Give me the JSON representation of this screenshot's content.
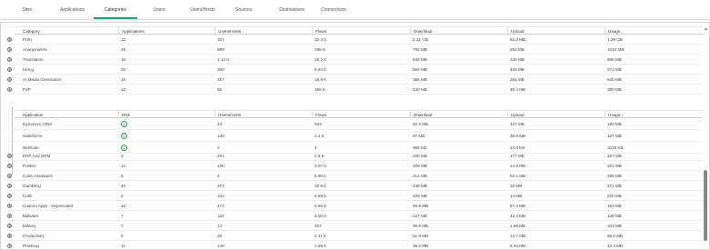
{
  "tabs": [
    "Sites",
    "Applications",
    "Categories",
    "Users",
    "Users/Hosts",
    "Sources",
    "Destinations",
    "Connections"
  ],
  "active_tab": "Categories",
  "top_table": {
    "headers": [
      "Category",
      "Applications",
      "Users/Hosts",
      "Flows",
      "Download",
      "Upload",
      "Usage"
    ],
    "sort_icon": "arrow-down-icon",
    "rows": [
      [
        "Porn",
        "12",
        "327",
        "25.4 K",
        "1.31 GB",
        "83.3 MB",
        "1.39 GB"
      ],
      [
        "Anonymizers",
        "28",
        "599",
        "158 K",
        "755 MB",
        "262 MB",
        "1010 MB"
      ],
      [
        "Translation",
        "16",
        "1.14 K",
        "18.2 K",
        "636 MB",
        "349 MB",
        "985 MB"
      ],
      [
        "Hiring",
        "34",
        "393",
        "9.64 K",
        "565 MB",
        "106 MB",
        "671 MB"
      ],
      [
        "AI Media Generators",
        "19",
        "357",
        "18.9 K",
        "386 MB",
        "254 MB",
        "640 MB"
      ],
      [
        "P2P",
        "12",
        "85",
        "186 K",
        "340 MB",
        "40.4 MB",
        "380 MB"
      ]
    ]
  },
  "sub_table": {
    "headers": [
      "Application",
      "Risk",
      "Users/Hosts",
      "Flows",
      "Download",
      "Upload",
      "Usage"
    ],
    "sort_icon": "arrow-down-icon",
    "rows": [
      [
        "Dynamics CRM",
        "1",
        "43",
        "593",
        "82.3 MB",
        "107 MB",
        "190 MB"
      ],
      [
        "Salesforce",
        "2",
        "138",
        "2.2 K",
        "97 MB",
        "39.8 MB",
        "137 MB"
      ],
      [
        "NetSuite",
        "2",
        "2",
        "4",
        "995 KB",
        "24.8 KB",
        "1020 KB"
      ]
    ]
  },
  "bottom_table": {
    "rows": [
      [
        "ERP And CRM",
        "3",
        "201",
        "2.8 K",
        "150 MB",
        "177 MB",
        "327 MB"
      ],
      [
        "Politics",
        "12",
        "180",
        "3.07 K",
        "306 MB",
        "14.8 MB",
        "321 MB"
      ],
      [
        "Code Assistants",
        "8",
        "4",
        "5.95 K",
        "214 MB",
        "84.1 MB",
        "298 MB"
      ],
      [
        "Gambling",
        "45",
        "373",
        "25.5 K",
        "239 MB",
        "32 MB",
        "271 MB"
      ],
      [
        "Cults",
        "3",
        "103",
        "5.59 K",
        "206 MB",
        "14 MB",
        "220 MB"
      ],
      [
        "Custom Apps - Deprecated",
        "12",
        "473",
        "5.65 K",
        "65.9 MB",
        "87.3 MB",
        "153 MB"
      ],
      [
        "Malware",
        "7",
        "126",
        "3.06 K",
        "127 MB",
        "12.3 MB",
        "139 MB"
      ],
      [
        "Military",
        "7",
        "14",
        "497",
        "99.8 MB",
        "1.98 MB",
        "101 MB"
      ],
      [
        "Productivity",
        "9",
        "28",
        "2.11 K",
        "51.9 MB",
        "14.7 MB",
        "66.6 MB"
      ],
      [
        "Phishing",
        "11",
        "149",
        "2.59 K",
        "36.2 MB",
        "6.04 MB",
        "42.4 MB"
      ]
    ]
  },
  "colors": {
    "accent": "#1e9e8a",
    "risk_low": "#28a745"
  }
}
